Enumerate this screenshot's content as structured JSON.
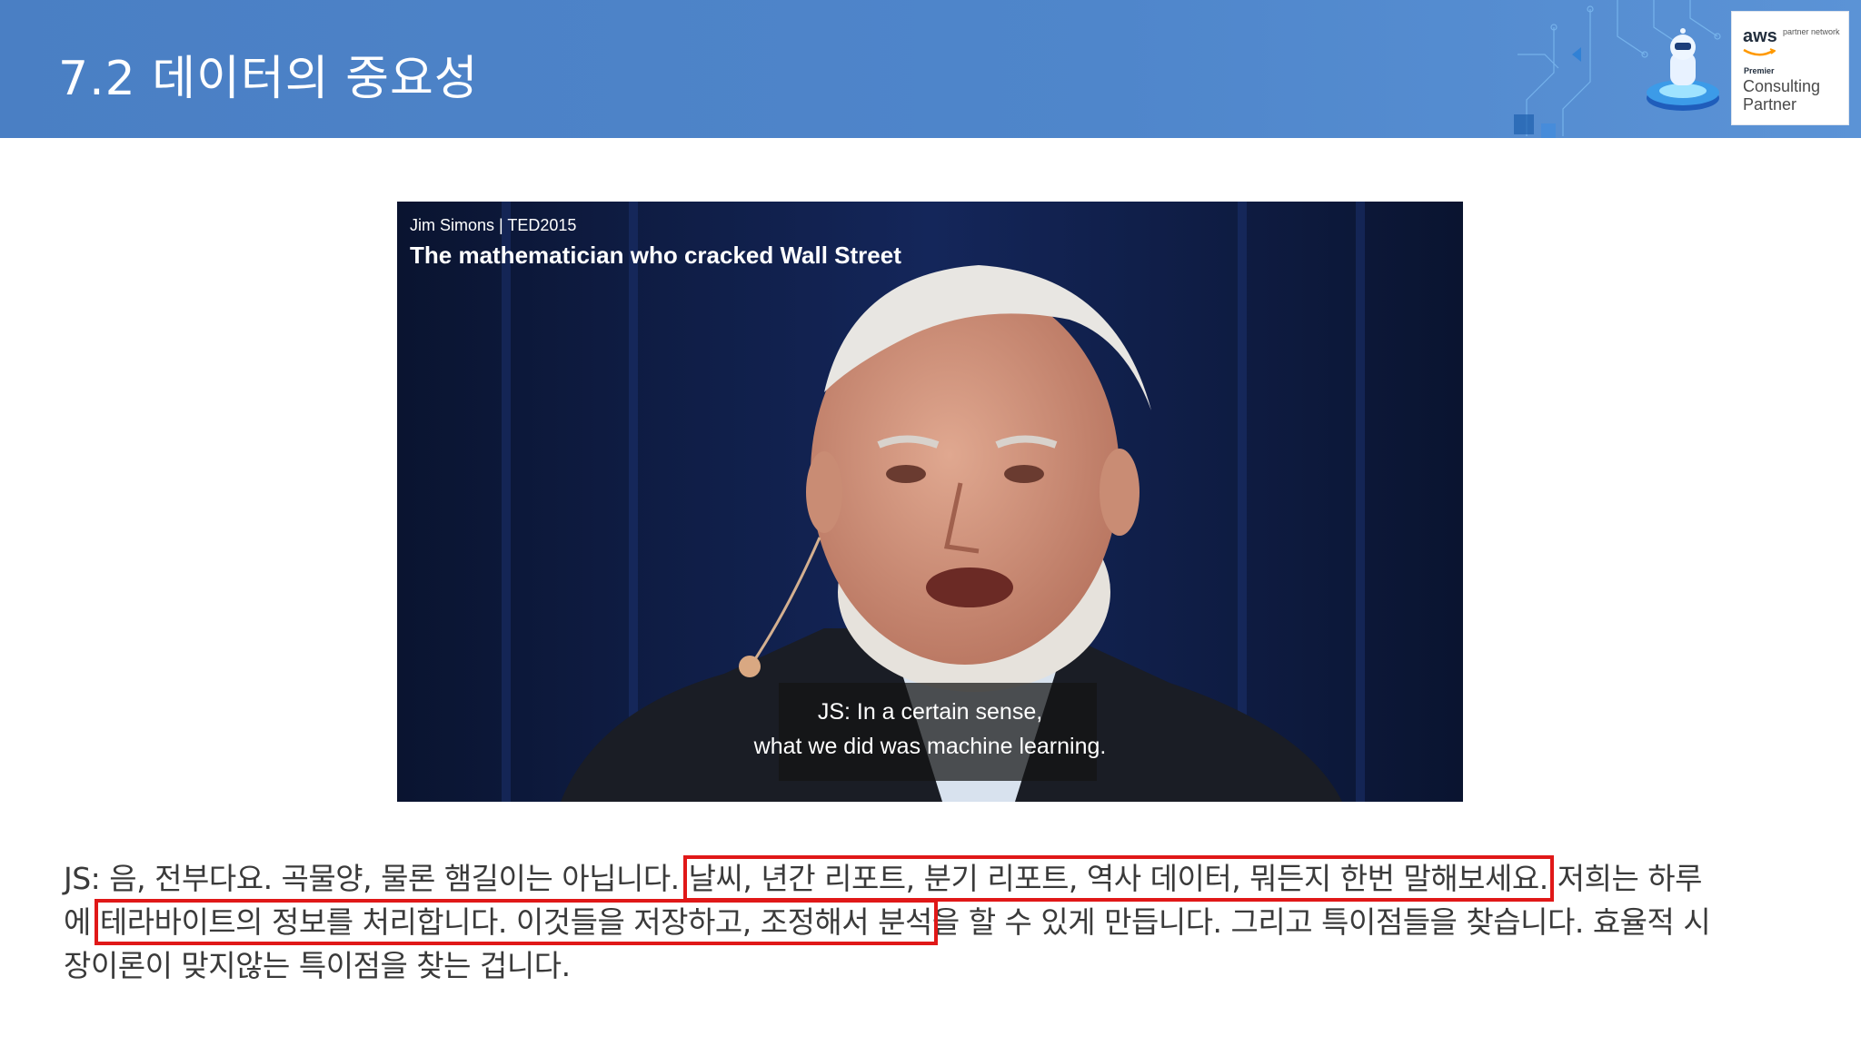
{
  "slide": {
    "title": "7.2 데이터의 중요성"
  },
  "partner_badge": {
    "logo": "aws",
    "partner_network": "partner network",
    "tier": "Premier",
    "type": "Consulting Partner"
  },
  "video": {
    "speaker_event": "Jim Simons | TED2015",
    "title": "The mathematician who cracked Wall Street",
    "caption_line_1": "JS: In a certain sense,",
    "caption_line_2": "what we did was machine learning."
  },
  "transcript": {
    "line1_a": "JS: 음, 전부다요. 곡물양, 물론 햄길이는 아닙니다. ",
    "line1_hl": "날씨, 년간 리포트, 분기 리포트, 역사 데이터, 뭐든지 한번 말해보세요.",
    "line1_b": " 저희는 하루",
    "line2_a": "에 ",
    "line2_hl": "테라바이트의 정보를 처리합니다. 이것들을 저장하고, 조정해서 분석",
    "line2_b": "을 할 수 있게 만듭니다. 그리고 특이점들을 찾습니다. 효율적 시",
    "line3": "장이론이 맞지않는 특이점을 찾는 겁니다."
  },
  "colors": {
    "header_blue": "#4f86cb",
    "highlight_red": "#e01818"
  }
}
